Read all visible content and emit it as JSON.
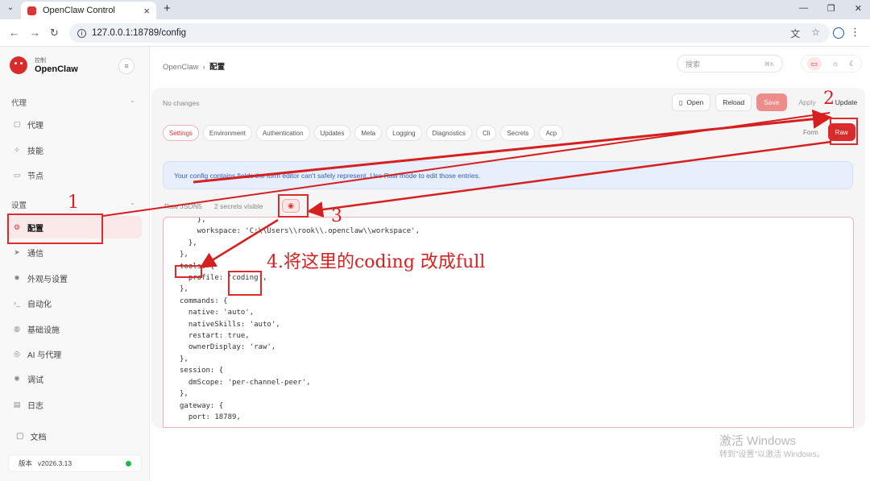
{
  "browser": {
    "tab_title": "OpenClaw Control",
    "url": "127.0.0.1:18789/config"
  },
  "sidebar": {
    "brand_sub": "控制",
    "brand_name": "OpenClaw",
    "section_agents": "代理",
    "items_agents": [
      "代理",
      "技能",
      "节点"
    ],
    "section_settings": "设置",
    "items_settings": [
      "配置",
      "通信",
      "外观与设置",
      "自动化",
      "基础设施",
      "AI 与代理",
      "调试",
      "日志"
    ],
    "docs": "文档",
    "version_label": "版本",
    "version_value": "v2026.3.13"
  },
  "header": {
    "crumb_root": "OpenClaw",
    "crumb_current": "配置",
    "search_placeholder": "搜索",
    "search_shortcut": "⌘K"
  },
  "config": {
    "status": "No changes",
    "actions": {
      "open": "Open",
      "reload": "Reload",
      "save": "Save",
      "apply": "Apply",
      "update": "Update"
    },
    "tabs": [
      "Settings",
      "Environment",
      "Authentication",
      "Updates",
      "Meta",
      "Logging",
      "Diagnostics",
      "Cli",
      "Secrets",
      "Acp"
    ],
    "active_tab": "Settings",
    "mode_form": "Form",
    "mode_raw": "Raw",
    "info": "Your config contains fields the form editor can't safely represent. Use Raw mode to edit those entries.",
    "raw_label": "Raw JSON5",
    "secrets_visible": "2 secrets visible",
    "code_lines": [
      "    },",
      "    workspace: 'C:\\\\Users\\\\rook\\\\.openclaw\\\\workspace',",
      "  },",
      "},",
      "tools: {",
      "  profile: 'coding',",
      "},",
      "commands: {",
      "  native: 'auto',",
      "  nativeSkills: 'auto',",
      "  restart: true,",
      "  ownerDisplay: 'raw',",
      "},",
      "session: {",
      "  dmScope: 'per-channel-peer',",
      "},",
      "gateway: {",
      "  port: 18789,"
    ]
  },
  "annotations": {
    "n1": "1",
    "n2": "2",
    "n3": "3",
    "step4": "4.将这里的coding 改成full",
    "color": "#d61f1f"
  },
  "watermark": {
    "line1": "激活 Windows",
    "line2": "转到\"设置\"以激活 Windows。"
  }
}
